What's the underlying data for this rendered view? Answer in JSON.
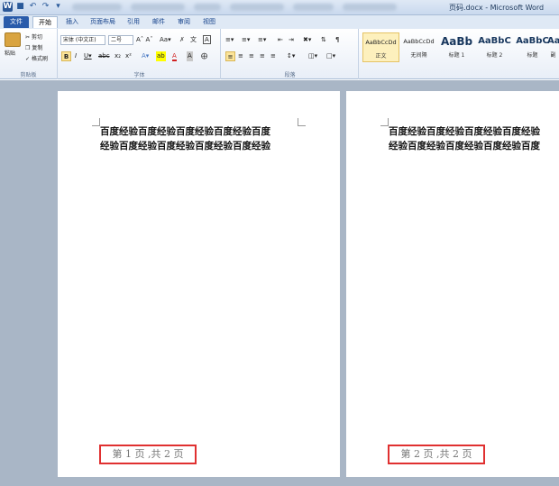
{
  "window": {
    "title": "页码.docx - Microsoft Word"
  },
  "tabs": [
    "文件",
    "开始",
    "插入",
    "页面布局",
    "引用",
    "邮件",
    "审阅",
    "视图"
  ],
  "clipboard": {
    "paste": "粘贴",
    "cut": "剪切",
    "copy": "复制",
    "format_painter": "格式刷",
    "group_label": "剪贴板"
  },
  "font": {
    "name": "宋体 (中文正)",
    "size": "二号",
    "group_label": "字体"
  },
  "paragraph": {
    "group_label": "段落"
  },
  "styles": [
    {
      "preview": "AaBbCcDd",
      "name": "正文"
    },
    {
      "preview": "AaBbCcDd",
      "name": "无间隔"
    },
    {
      "preview": "AaBb",
      "name": "标题 1"
    },
    {
      "preview": "AaBbC",
      "name": "标题 2"
    },
    {
      "preview": "AaBbC",
      "name": "标题"
    },
    {
      "preview": "Aa",
      "name": "副"
    }
  ],
  "pages": [
    {
      "lines": [
        "百度经验百度经验百度经验百度经验百度",
        "经验百度经验百度经验百度经验百度经验"
      ],
      "footer": "第 1 页 ,共 2 页"
    },
    {
      "lines": [
        "百度经验百度经验百度经验百度经验",
        "经验百度经验百度经验百度经验百度"
      ],
      "footer": "第 2 页 ,共 2 页"
    }
  ]
}
